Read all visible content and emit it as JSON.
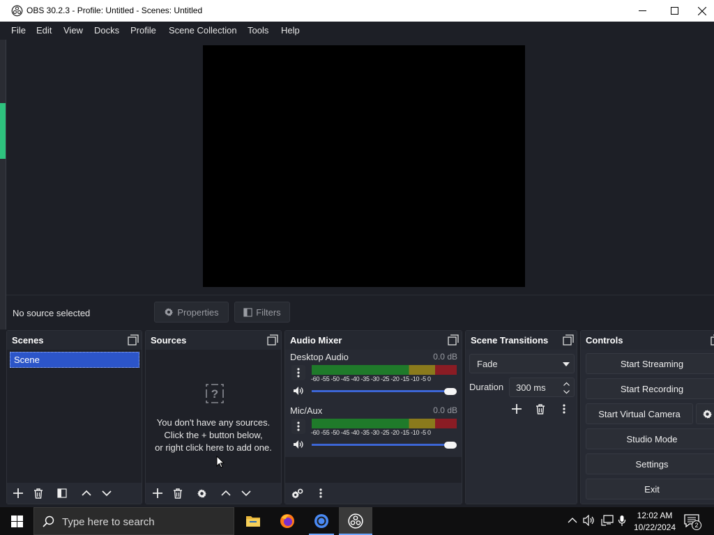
{
  "window": {
    "title": "OBS 30.2.3 - Profile: Untitled - Scenes: Untitled"
  },
  "menu": [
    "File",
    "Edit",
    "View",
    "Docks",
    "Profile",
    "Scene Collection",
    "Tools",
    "Help"
  ],
  "source_toolbar": {
    "status": "No source selected",
    "properties_label": "Properties",
    "filters_label": "Filters"
  },
  "scenes_dock": {
    "title": "Scenes",
    "items": [
      "Scene"
    ]
  },
  "sources_dock": {
    "title": "Sources",
    "empty_line1": "You don't have any sources.",
    "empty_line2": "Click the + button below,",
    "empty_line3": "or right click here to add one."
  },
  "audio_mixer": {
    "title": "Audio Mixer",
    "scale": [
      "-60",
      "-55",
      "-50",
      "-45",
      "-40",
      "-35",
      "-30",
      "-25",
      "-20",
      "-15",
      "-10",
      "-5",
      "0"
    ],
    "channels": [
      {
        "name": "Desktop Audio",
        "db": "0.0 dB",
        "volume": 1.0
      },
      {
        "name": "Mic/Aux",
        "db": "0.0 dB",
        "volume": 1.0
      }
    ]
  },
  "transitions_dock": {
    "title": "Scene Transitions",
    "transition": "Fade",
    "duration_label": "Duration",
    "duration_value": "300 ms"
  },
  "controls_dock": {
    "title": "Controls",
    "start_streaming": "Start Streaming",
    "start_recording": "Start Recording",
    "start_virtual_camera": "Start Virtual Camera",
    "studio_mode": "Studio Mode",
    "settings": "Settings",
    "exit": "Exit"
  },
  "taskbar": {
    "search_placeholder": "Type here to search",
    "time": "12:02 AM",
    "date": "10/22/2024",
    "notification_count": "2"
  },
  "colors": {
    "accent": "#2c55c9",
    "meter_green": "#1f7a2a",
    "meter_yellow": "#8a7a1c",
    "meter_red": "#8a1c24"
  }
}
